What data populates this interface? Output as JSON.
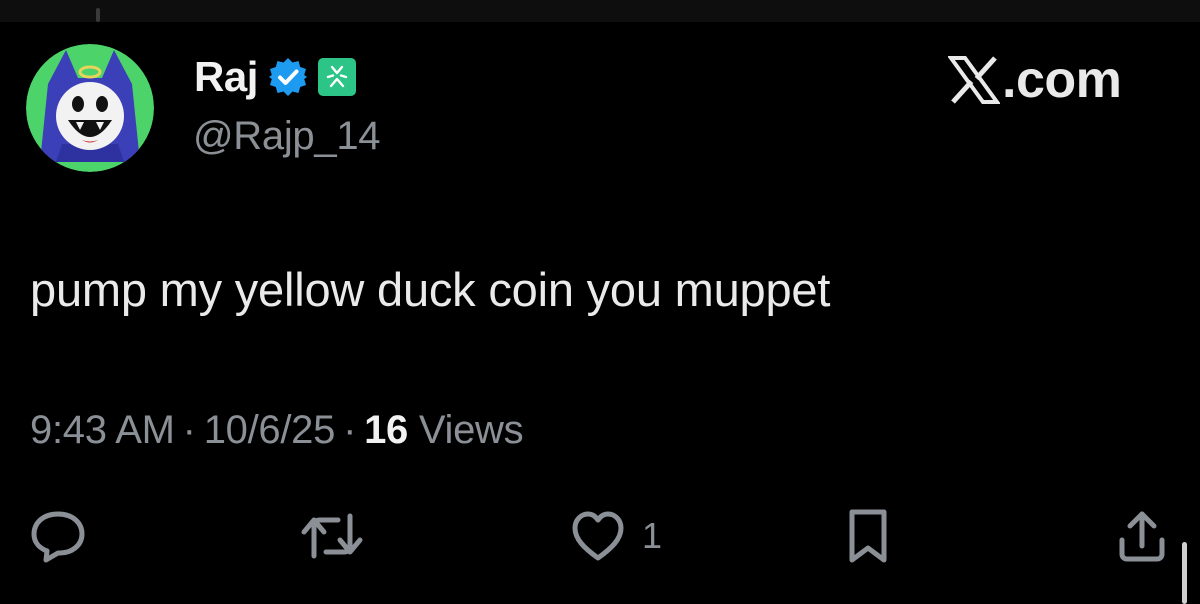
{
  "author": {
    "display_name": "Raj",
    "handle": "@Rajp_14",
    "avatar_icon": "jack-frost-avatar-icon",
    "verified_icon": "verified-badge-icon",
    "affiliation_icon": "affiliate-badge-icon"
  },
  "brand": {
    "logo_icon": "x-logo-icon",
    "text": ".com"
  },
  "post": {
    "text": "pump my yellow duck coin you muppet"
  },
  "meta": {
    "time": "9:43 AM",
    "separator": "·",
    "date": "10/6/25",
    "views_count": "16",
    "views_label": "Views"
  },
  "actions": {
    "reply_icon": "reply-icon",
    "repost_icon": "repost-icon",
    "like_icon": "like-icon",
    "like_count": "1",
    "bookmark_icon": "bookmark-icon",
    "share_icon": "share-icon"
  },
  "colors": {
    "background": "#000000",
    "text_primary": "#e7e9ea",
    "text_secondary": "#8b9097",
    "verified_blue": "#1d9bf0",
    "affiliate_green": "#2cc487",
    "avatar_bg": "#4cd36a"
  }
}
